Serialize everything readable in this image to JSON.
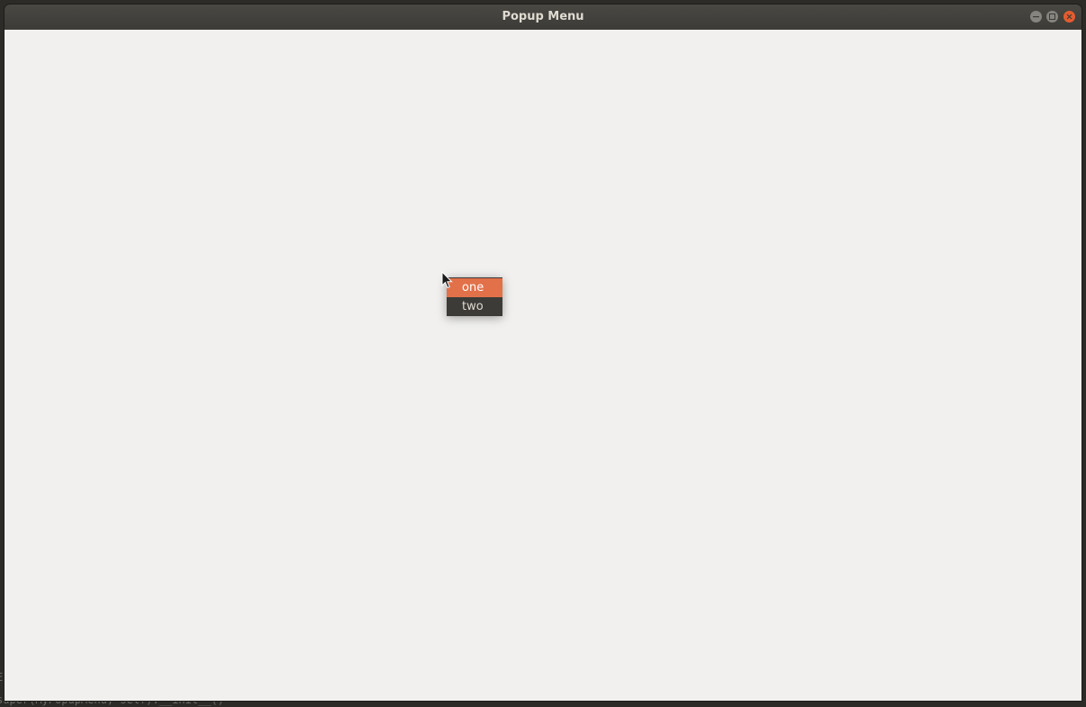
{
  "window": {
    "title": "Popup Menu",
    "controls": {
      "minimize_icon": "minimize-icon",
      "maximize_icon": "maximize-icon",
      "close_icon": "close-icon"
    }
  },
  "popup_menu": {
    "items": [
      {
        "label": "one",
        "highlighted": true
      },
      {
        "label": "two",
        "highlighted": false
      }
    ]
  },
  "terminal": {
    "lines": [
      "E",
      "super(MyPopupMenu, self).__init__()"
    ]
  },
  "colors": {
    "highlight": "#e2714a",
    "menu_bg": "#3c3b37",
    "window_bg": "#f1f0ee",
    "titlebar": "#3c3b37",
    "close_button": "#e25c2f"
  }
}
